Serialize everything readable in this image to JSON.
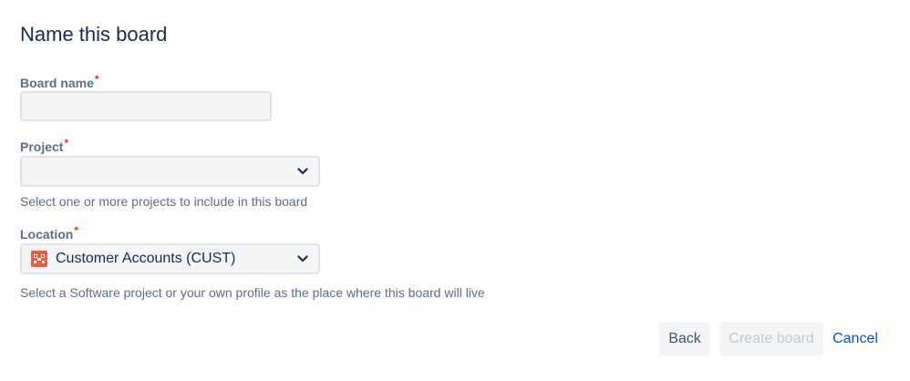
{
  "dialog": {
    "title": "Name this board"
  },
  "board_name": {
    "label": "Board name",
    "required_marker": "*",
    "value": "",
    "placeholder": ""
  },
  "project": {
    "label": "Project",
    "required_marker": "*",
    "selected_value": "",
    "help_text": "Select one or more projects to include in this board"
  },
  "location": {
    "label": "Location",
    "required_marker": "*",
    "selected_value": "Customer Accounts (CUST)",
    "project_icon": "project-avatar-icon",
    "help_text": "Select a Software project or your own profile as the place where this board will live"
  },
  "actions": {
    "back_label": "Back",
    "create_label": "Create board",
    "cancel_label": "Cancel"
  },
  "colors": {
    "text_primary": "#172b4d",
    "text_subtle": "#5e6c84",
    "required": "#de350b",
    "link": "#0052cc",
    "input_bg": "#f4f5f7",
    "input_border": "#dfe1e6",
    "disabled_text": "#c1c7d0"
  }
}
